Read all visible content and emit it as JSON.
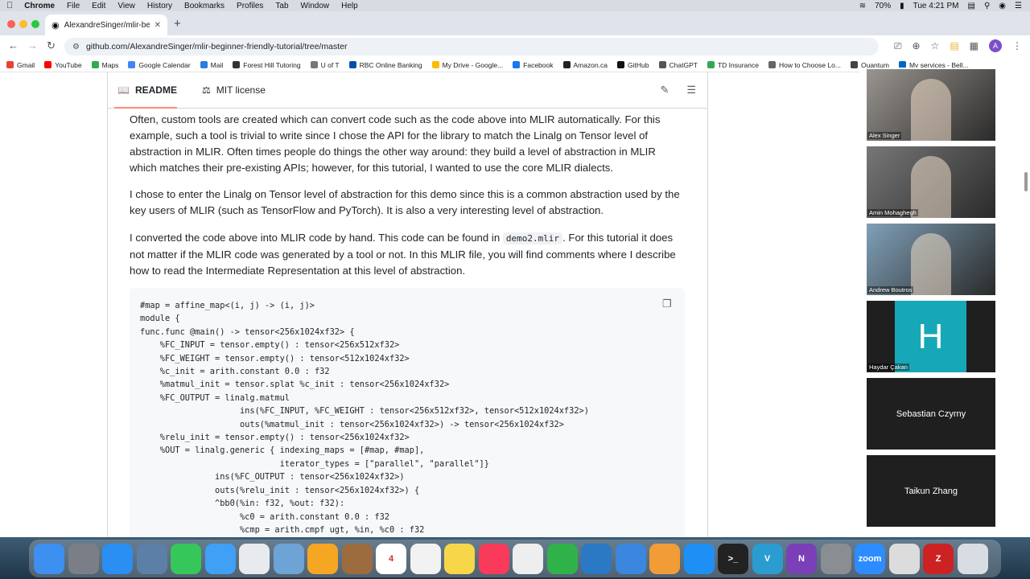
{
  "menubar": {
    "items": [
      "Chrome",
      "File",
      "Edit",
      "View",
      "History",
      "Bookmarks",
      "Profiles",
      "Tab",
      "Window",
      "Help"
    ],
    "battery": "70%",
    "clock": "Tue 4:21 PM"
  },
  "tab": {
    "title": "AlexandreSinger/mlir-beginne"
  },
  "url": "github.com/AlexandreSinger/mlir-beginner-friendly-tutorial/tree/master",
  "bookmarks": [
    {
      "label": "Gmail",
      "color": "#ea4335"
    },
    {
      "label": "YouTube",
      "color": "#ff0000"
    },
    {
      "label": "Maps",
      "color": "#34a853"
    },
    {
      "label": "Google Calendar",
      "color": "#4285f4"
    },
    {
      "label": "Mail",
      "color": "#2a7de1"
    },
    {
      "label": "Forest Hill Tutoring",
      "color": "#333333"
    },
    {
      "label": "U of T",
      "color": "#777777"
    },
    {
      "label": "RBC Online Banking",
      "color": "#0051a5"
    },
    {
      "label": "My Drive - Google...",
      "color": "#fbbc04"
    },
    {
      "label": "Facebook",
      "color": "#1877f2"
    },
    {
      "label": "Amazon.ca",
      "color": "#222222"
    },
    {
      "label": "GitHub",
      "color": "#111111"
    },
    {
      "label": "ChatGPT",
      "color": "#555555"
    },
    {
      "label": "TD Insurance",
      "color": "#34a853"
    },
    {
      "label": "How to Choose Lo...",
      "color": "#666666"
    },
    {
      "label": "Quantum",
      "color": "#444444"
    },
    {
      "label": "My services - Bell...",
      "color": "#0066cc"
    }
  ],
  "readme": {
    "tab_readme": "README",
    "tab_license": "MIT license",
    "p1": "Often, custom tools are created which can convert code such as the code above into MLIR automatically. For this example, such a tool is trivial to write since I chose the API for the library to match the Linalg on Tensor level of abstraction in MLIR. Often times people do things the other way around: they build a level of abstraction in MLIR which matches their pre-existing APIs; however, for this tutorial, I wanted to use the core MLIR dialects.",
    "p2": "I chose to enter the Linalg on Tensor level of abstraction for this demo since this is a common abstraction used by the key users of MLIR (such as TensorFlow and PyTorch). It is also a very interesting level of abstraction.",
    "p3_before": "I converted the code above into MLIR code by hand. This code can be found in ",
    "p3_code": "demo2.mlir",
    "p3_after": ". For this tutorial it does not matter if the MLIR code was generated by a tool or not. In this MLIR file, you will find comments where I describe how to read the Intermediate Representation at this level of abstraction."
  },
  "code_lines": [
    "#map = affine_map<(i, j) -> (i, j)>",
    "module {",
    "func.func @main() -> tensor<256x1024xf32> {",
    "    %FC_INPUT = tensor.empty() : tensor<256x512xf32>",
    "    %FC_WEIGHT = tensor.empty() : tensor<512x1024xf32>",
    "    %c_init = arith.constant 0.0 : f32",
    "    %matmul_init = tensor.splat %c_init : tensor<256x1024xf32>",
    "    %FC_OUTPUT = linalg.matmul",
    "                    ins(%FC_INPUT, %FC_WEIGHT : tensor<256x512xf32>, tensor<512x1024xf32>)",
    "                    outs(%matmul_init : tensor<256x1024xf32>) -> tensor<256x1024xf32>",
    "    %relu_init = tensor.empty() : tensor<256x1024xf32>",
    "    %OUT = linalg.generic { indexing_maps = [#map, #map],",
    "                            iterator_types = [\"parallel\", \"parallel\"]}",
    "               ins(%FC_OUTPUT : tensor<256x1024xf32>)",
    "               outs(%relu_init : tensor<256x1024xf32>) {",
    "               ^bb0(%in: f32, %out: f32):",
    "                    %c0 = arith.constant 0.0 : f32",
    "                    %cmp = arith.cmpf ugt, %in, %c0 : f32"
  ],
  "participants": [
    {
      "name": "Alex Singer",
      "type": "video",
      "color": "#9a9590"
    },
    {
      "name": "Amin Mohaghegh",
      "type": "video",
      "color": "#777777"
    },
    {
      "name": "Andrew Boutros",
      "type": "video",
      "color": "#7fa0b8"
    },
    {
      "name": "Haydar Çakan",
      "type": "avatar",
      "initial": "H"
    },
    {
      "name": "Sebastian Czyrny",
      "type": "name"
    },
    {
      "name": "Taikun Zhang",
      "type": "name"
    }
  ],
  "dock": [
    {
      "name": "finder-icon",
      "color": "#3d8ff0",
      "label": ""
    },
    {
      "name": "launchpad-icon",
      "color": "#7a7f87",
      "label": ""
    },
    {
      "name": "safari-icon",
      "color": "#2a8ef2",
      "label": ""
    },
    {
      "name": "photo-app-icon",
      "color": "#5c7fa8",
      "label": ""
    },
    {
      "name": "facetime-icon",
      "color": "#35c759",
      "label": ""
    },
    {
      "name": "messages-icon",
      "color": "#3fa0f5",
      "label": ""
    },
    {
      "name": "chrome-icon",
      "color": "#e8eaed",
      "label": ""
    },
    {
      "name": "preview-icon",
      "color": "#6ea3d6",
      "label": ""
    },
    {
      "name": "photos-icon",
      "color": "#f5a623",
      "label": ""
    },
    {
      "name": "notebook-icon",
      "color": "#9c6b3e",
      "label": ""
    },
    {
      "name": "calendar-icon",
      "color": "#ffffff",
      "label": "4"
    },
    {
      "name": "reminders-icon",
      "color": "#f2f2f2",
      "label": ""
    },
    {
      "name": "notes-icon",
      "color": "#f7d64a",
      "label": ""
    },
    {
      "name": "music-icon",
      "color": "#fa3a5a",
      "label": ""
    },
    {
      "name": "textedit-icon",
      "color": "#eeeeee",
      "label": ""
    },
    {
      "name": "numbers-icon",
      "color": "#2fb24a",
      "label": ""
    },
    {
      "name": "vscode-icon",
      "color": "#2b78c5",
      "label": ""
    },
    {
      "name": "keynote-icon",
      "color": "#3b87e0",
      "label": ""
    },
    {
      "name": "pages-icon",
      "color": "#f29c38",
      "label": ""
    },
    {
      "name": "appstore-icon",
      "color": "#1e90f5",
      "label": ""
    },
    {
      "name": "terminal-icon",
      "color": "#222222",
      "label": ">_"
    },
    {
      "name": "vivado-icon",
      "color": "#2a9cd0",
      "label": "V"
    },
    {
      "name": "onenote-icon",
      "color": "#7b3fb8",
      "label": "N"
    },
    {
      "name": "settings-icon",
      "color": "#8a8d92",
      "label": ""
    },
    {
      "name": "zoom-icon",
      "color": "#2d8cff",
      "label": "zoom"
    },
    {
      "name": "remote-desktop-icon",
      "color": "#dcdcdc",
      "label": ""
    },
    {
      "name": "app-z-icon",
      "color": "#cc2222",
      "label": "Z"
    },
    {
      "name": "trash-icon",
      "color": "#d8dde3",
      "label": ""
    }
  ]
}
